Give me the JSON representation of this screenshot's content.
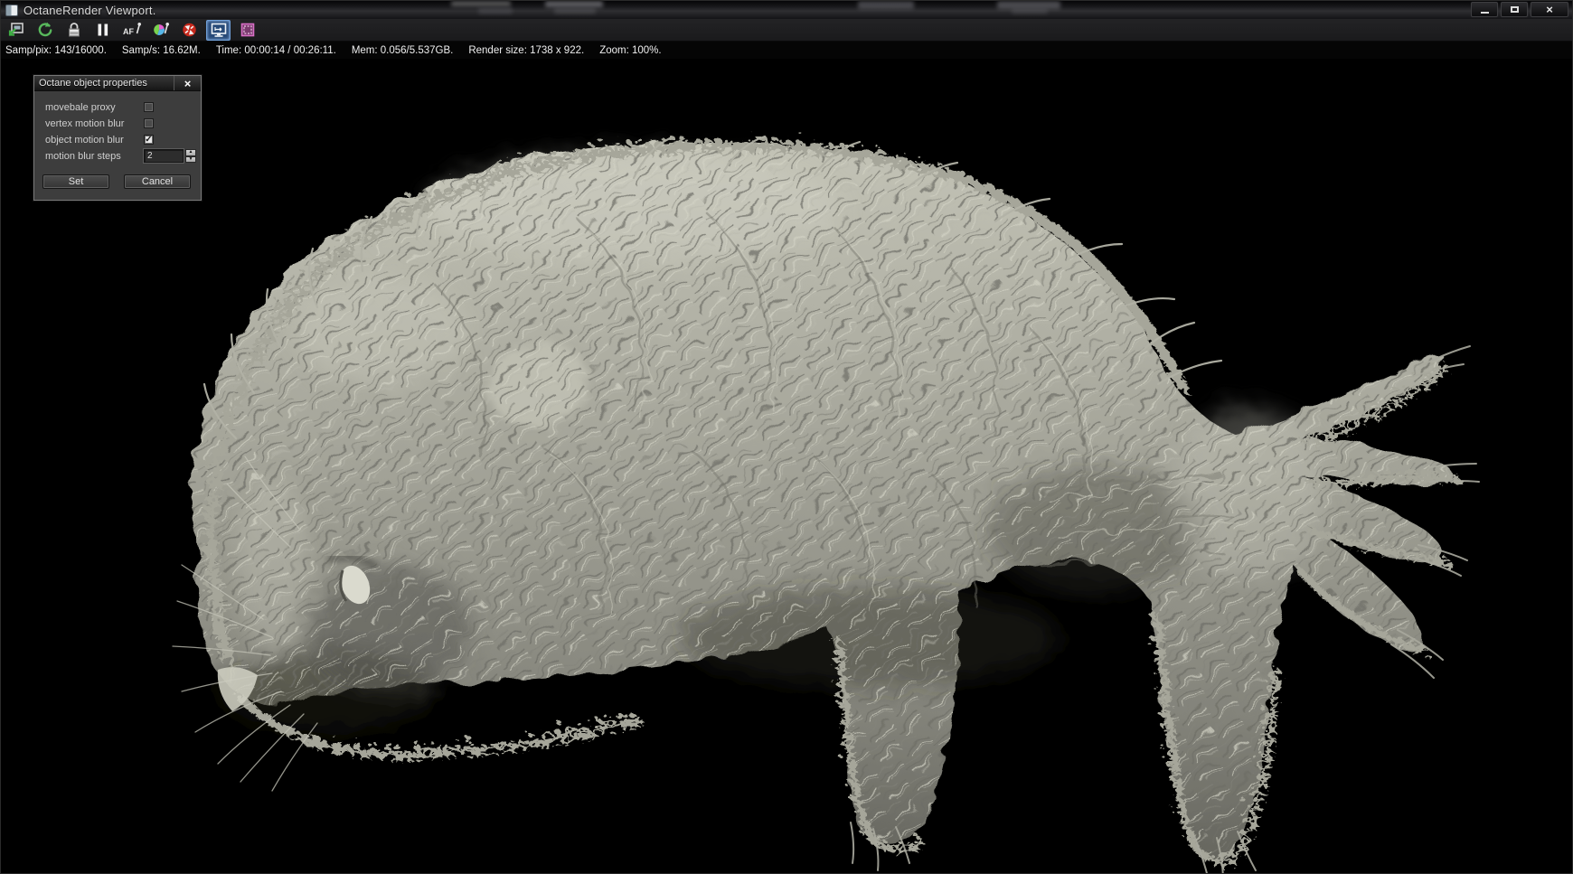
{
  "window": {
    "title": "OctaneRender Viewport.",
    "controls": [
      "minimize",
      "maximize",
      "close"
    ]
  },
  "toolbar": {
    "buttons": [
      {
        "name": "save-render",
        "active": false
      },
      {
        "name": "restart-render",
        "active": false
      },
      {
        "name": "lock-resolution",
        "active": false
      },
      {
        "name": "pause-render",
        "active": false
      },
      {
        "name": "autofocus-pick",
        "active": false
      },
      {
        "name": "white-balance-pick",
        "active": false
      },
      {
        "name": "reset-render",
        "active": false
      },
      {
        "name": "viewport-lock",
        "active": true
      },
      {
        "name": "render-region",
        "active": false
      }
    ]
  },
  "statusbar": {
    "segments": [
      "Samp/pix: 143/16000.",
      "Samp/s: 16.62M.",
      "Time: 00:00:14 / 00:26:11.",
      "Mem: 0.056/5.537GB.",
      "Render size: 1738 x 922.",
      "Zoom: 100%."
    ]
  },
  "dialog": {
    "title": "Octane object properties",
    "close_glyph": "×",
    "check_glyph": "✓",
    "rows": [
      {
        "label": "movebale proxy",
        "type": "checkbox",
        "checked": false
      },
      {
        "label": "vertex motion blur",
        "type": "checkbox",
        "checked": false
      },
      {
        "label": "object motion blur",
        "type": "checkbox",
        "checked": true
      },
      {
        "label": "motion blur steps",
        "type": "spinner",
        "value": "2"
      }
    ],
    "spinner": {
      "up_glyph": "▲",
      "down_glyph": "▼"
    },
    "buttons": {
      "set": "Set",
      "cancel": "Cancel"
    }
  },
  "viewport": {
    "background_color": "#000000",
    "subject": "grayscale clay render of a fur-covered seal-like creature facing left, tail fan of digits at right, two limbs hanging below",
    "fur_color": "#a8a89c"
  }
}
